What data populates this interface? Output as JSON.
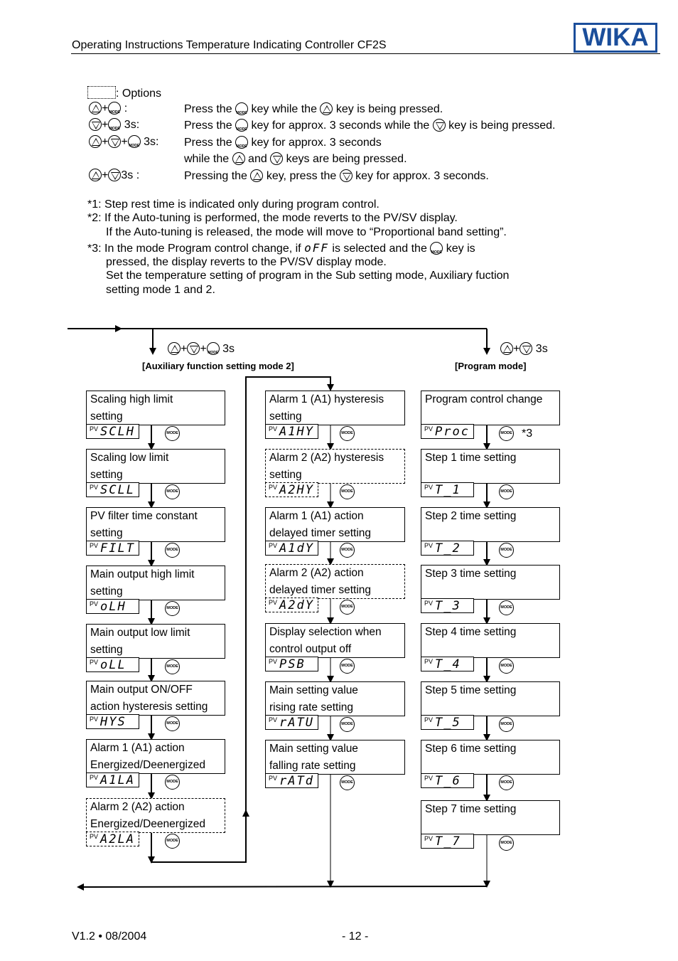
{
  "header": {
    "title": "Operating Instructions Temperature Indicating Controller CF2S",
    "logo": "WIKA",
    "logo_color": "#1b4e9b"
  },
  "legend": {
    "options_label": ": Options",
    "rows": [
      {
        "keys_suffix": " :",
        "desc": [
          "Press the ",
          " key while the ",
          " key is being pressed."
        ]
      },
      {
        "keys_suffix": " 3s:",
        "desc": [
          "Press the ",
          " key for approx. 3 seconds while the ",
          " key is being pressed."
        ]
      },
      {
        "keys_suffix": " 3s:",
        "desc": [
          "Press the ",
          " key for approx. 3 seconds"
        ],
        "desc2": [
          "while the ",
          " and ",
          " keys are being  pressed."
        ]
      },
      {
        "keys_suffix": "3s :",
        "desc": [
          "Pressing the ",
          " key, press the ",
          " key for approx. 3 seconds."
        ]
      }
    ]
  },
  "notes": {
    "n1": "*1: Step rest time is indicated only during program control.",
    "n2a": "*2: If the Auto-tuning is performed, the mode reverts to the PV/SV display.",
    "n2b": "If the Auto-tuning is released, the mode will move to “Proportional band setting”.",
    "n3a_1": "*3: In the mode Program control change, if ",
    "n3a_code": "oFF",
    "n3a_2": " is selected and the ",
    "n3a_3": " key is",
    "n3b": "pressed, the display reverts to the PV/SV display mode.",
    "n3c": "Set the temperature setting of program in the Sub setting mode, Auxiliary fuction",
    "n3d": "setting mode 1 and 2."
  },
  "flow": {
    "aux_keys_suffix": "3s",
    "aux_title": "[Auxiliary function setting mode 2]",
    "prog_keys_suffix": "3s",
    "prog_title": "[Program mode]",
    "pv_label": "PV",
    "col1": [
      {
        "l1": "Scaling high limit",
        "l2": "setting",
        "code": "SCLH",
        "optional": false
      },
      {
        "l1": "Scaling low limit",
        "l2": "setting",
        "code": "SCLL",
        "optional": false
      },
      {
        "l1": "PV filter time constant",
        "l2": "setting",
        "code": "FILT",
        "optional": false
      },
      {
        "l1": "Main output high limit",
        "l2": "setting",
        "code": "oLH",
        "optional": false
      },
      {
        "l1": "Main output low limit",
        "l2": "setting",
        "code": "oLL",
        "optional": false
      },
      {
        "l1": "Main output ON/OFF",
        "l2": "action hysteresis setting",
        "code": "HYS",
        "optional": false
      },
      {
        "l1": "Alarm 1 (A1) action",
        "l2": "Energized/Deenergized",
        "code": "A1LA",
        "optional": false
      },
      {
        "l1": "Alarm 2 (A2) action",
        "l2": "Energized/Deenergized",
        "code": "A2LA",
        "optional": true
      }
    ],
    "col2": [
      {
        "l1": "Alarm 1 (A1) hysteresis",
        "l2": "setting",
        "code": "A1HY",
        "optional": false
      },
      {
        "l1": "Alarm 2 (A2) hysteresis",
        "l2": "setting",
        "code": "A2HY",
        "optional": true
      },
      {
        "l1": "Alarm 1 (A1) action",
        "l2": "delayed timer setting",
        "code": "A1dY",
        "optional": false
      },
      {
        "l1": "Alarm 2 (A2) action",
        "l2": "delayed timer setting",
        "code": "A2dY",
        "optional": true
      },
      {
        "l1": "Display selection when",
        "l2": "control output off",
        "code": "PSB",
        "optional": false
      },
      {
        "l1": "Main setting value",
        "l2": "rising rate setting",
        "code": "rATU",
        "optional": false
      },
      {
        "l1": "Main setting value",
        "l2": "falling rate setting",
        "code": "rATd",
        "optional": false
      }
    ],
    "col3": [
      {
        "l1": "Program control change",
        "l2": "",
        "code": "Proc",
        "optional": false,
        "note": "*3"
      },
      {
        "l1": "Step 1 time setting",
        "l2": "",
        "code": "T_1",
        "optional": false
      },
      {
        "l1": "Step 2 time setting",
        "l2": "",
        "code": "T_2",
        "optional": false
      },
      {
        "l1": "Step 3 time setting",
        "l2": "",
        "code": "T_3",
        "optional": false
      },
      {
        "l1": "Step 4 time setting",
        "l2": "",
        "code": "T_4",
        "optional": false
      },
      {
        "l1": "Step 5 time setting",
        "l2": "",
        "code": "T_5",
        "optional": false
      },
      {
        "l1": "Step 6 time setting",
        "l2": "",
        "code": "T_6",
        "optional": false
      },
      {
        "l1": "Step 7 time setting",
        "l2": "",
        "code": "T_7",
        "optional": false
      }
    ]
  },
  "footer": {
    "version": "V1.2  •  08/2004",
    "page": "- 12 -"
  }
}
